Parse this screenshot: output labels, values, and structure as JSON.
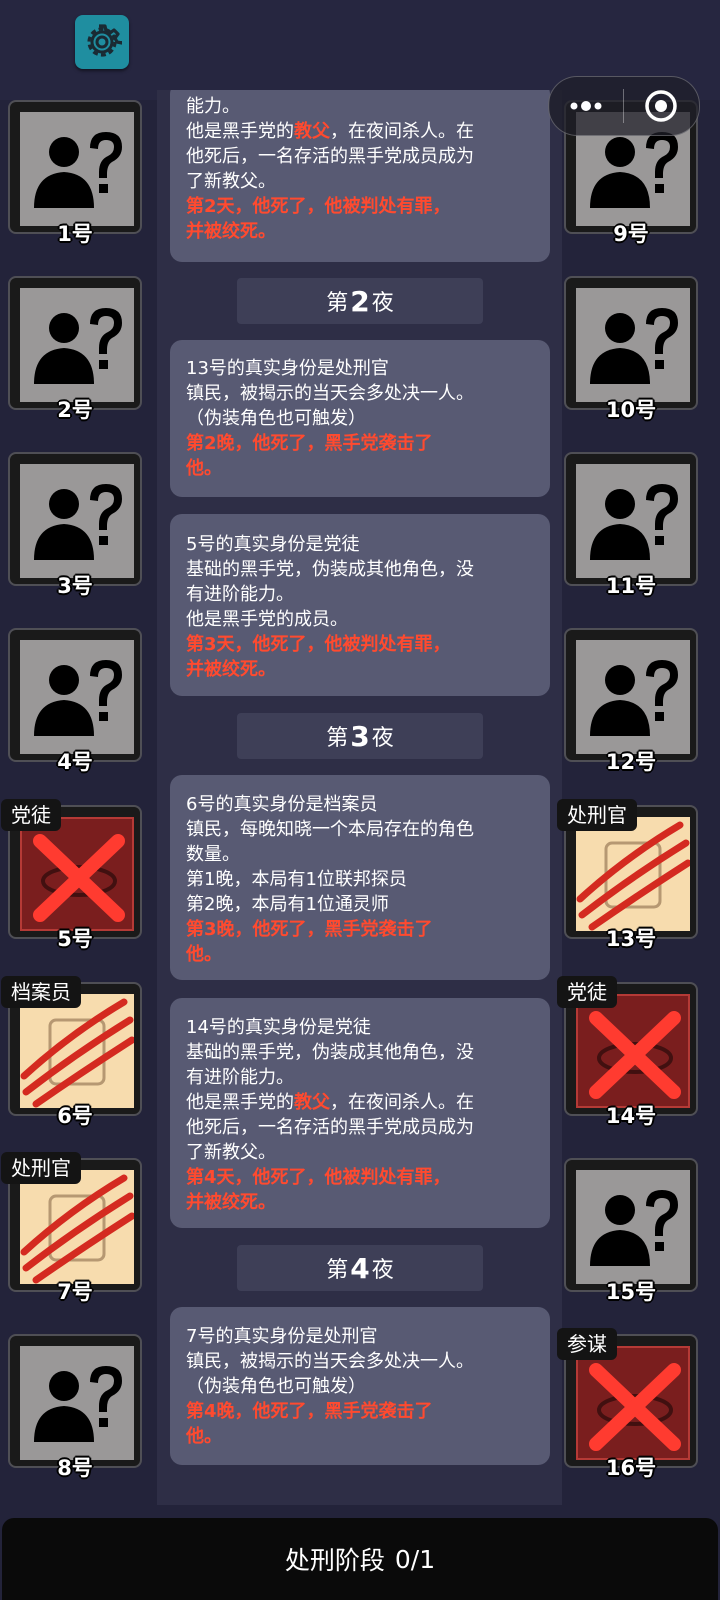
{
  "capsule": {
    "more_icon": "more-dots-icon",
    "close_icon": "target-circle-icon"
  },
  "settings": {
    "icon": "gear-icon",
    "color": "#1f8ea0"
  },
  "colors": {
    "highlight": "#ff4a2f",
    "card": "#585a73",
    "dead_tile": "#7a1e1e",
    "revealed_tile": "#f7dcae"
  },
  "players_left": [
    {
      "num": "1号",
      "state": "unknown"
    },
    {
      "num": "2号",
      "state": "unknown"
    },
    {
      "num": "3号",
      "state": "unknown"
    },
    {
      "num": "4号",
      "state": "unknown"
    },
    {
      "num": "5号",
      "state": "dead-x",
      "role": "党徒"
    },
    {
      "num": "6号",
      "state": "revealed-slashed",
      "role": "档案员"
    },
    {
      "num": "7号",
      "state": "revealed-slashed",
      "role": "处刑官"
    },
    {
      "num": "8号",
      "state": "unknown"
    }
  ],
  "players_right": [
    {
      "num": "9号",
      "state": "unknown"
    },
    {
      "num": "10号",
      "state": "unknown"
    },
    {
      "num": "11号",
      "state": "unknown"
    },
    {
      "num": "12号",
      "state": "unknown"
    },
    {
      "num": "13号",
      "state": "revealed-slashed",
      "role": "处刑官"
    },
    {
      "num": "14号",
      "state": "dead-x",
      "role": "党徒"
    },
    {
      "num": "15号",
      "state": "unknown"
    },
    {
      "num": "16号",
      "state": "dead-x",
      "role": "参谋"
    }
  ],
  "log": {
    "card0": {
      "l1": "能力。",
      "l2a": "他是黑手党的",
      "l2b": "教父",
      "l2c": "，在夜间杀人。在",
      "l3": "他死后，一名存活的黑手党成员成为",
      "l4": "了新教父。",
      "r1": "第2天，他死了，他被判处有罪，",
      "r2": "并被绞死。"
    },
    "night2": {
      "pre": "第",
      "num": "2",
      "post": "夜"
    },
    "card1": {
      "l1": "13号的真实身份是处刑官",
      "l2": "镇民，被揭示的当天会多处决一人。",
      "l3": "（伪装角色也可触发）",
      "r1": "第2晚，他死了，黑手党袭击了",
      "r2": "他。"
    },
    "card2": {
      "l1": "5号的真实身份是党徒",
      "l2": "基础的黑手党，伪装成其他角色，没",
      "l3": "有进阶能力。",
      "l4": "他是黑手党的成员。",
      "r1": "第3天，他死了，他被判处有罪，",
      "r2": "并被绞死。"
    },
    "night3": {
      "pre": "第",
      "num": "3",
      "post": "夜"
    },
    "card3": {
      "l1": "6号的真实身份是档案员",
      "l2": "镇民，每晚知晓一个本局存在的角色",
      "l3": "数量。",
      "l4": "第1晚，本局有1位联邦探员",
      "l5": "第2晚，本局有1位通灵师",
      "r1": "第3晚，他死了，黑手党袭击了",
      "r2": "他。"
    },
    "card4": {
      "l1": "14号的真实身份是党徒",
      "l2": "基础的黑手党，伪装成其他角色，没",
      "l3": "有进阶能力。",
      "l4a": "他是黑手党的",
      "l4b": "教父",
      "l4c": "，在夜间杀人。在",
      "l5": "他死后，一名存活的黑手党成员成为",
      "l6": "了新教父。",
      "r1": "第4天，他死了，他被判处有罪，",
      "r2": "并被绞死。"
    },
    "night4": {
      "pre": "第",
      "num": "4",
      "post": "夜"
    },
    "card5": {
      "l1": "7号的真实身份是处刑官",
      "l2": "镇民，被揭示的当天会多处决一人。",
      "l3": "（伪装角色也可触发）",
      "r1": "第4晚，他死了，黑手党袭击了",
      "r2": "他。"
    }
  },
  "bottom": {
    "phase": "处刑阶段",
    "count": "0/1"
  }
}
